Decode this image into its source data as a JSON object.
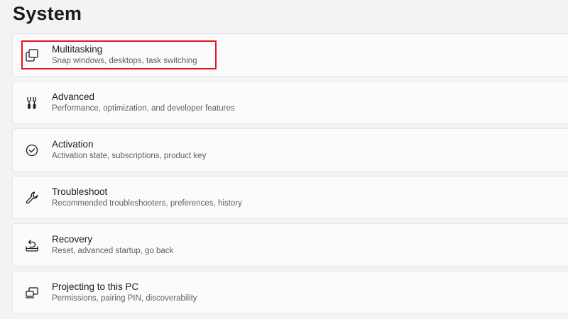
{
  "page": {
    "title": "System"
  },
  "colors": {
    "highlight": "#e8141e",
    "card_background": "#fbfbfb",
    "page_background": "#f3f3f3"
  },
  "items": [
    {
      "icon": "multitasking-icon",
      "title": "Multitasking",
      "description": "Snap windows, desktops, task switching"
    },
    {
      "icon": "advanced-tools-icon",
      "title": "Advanced",
      "description": "Performance, optimization, and developer features"
    },
    {
      "icon": "activation-check-icon",
      "title": "Activation",
      "description": "Activation state, subscriptions, product key"
    },
    {
      "icon": "wrench-icon",
      "title": "Troubleshoot",
      "description": "Recommended troubleshooters, preferences, history"
    },
    {
      "icon": "recovery-icon",
      "title": "Recovery",
      "description": "Reset, advanced startup, go back"
    },
    {
      "icon": "projecting-icon",
      "title": "Projecting to this PC",
      "description": "Permissions, pairing PIN, discoverability"
    }
  ]
}
